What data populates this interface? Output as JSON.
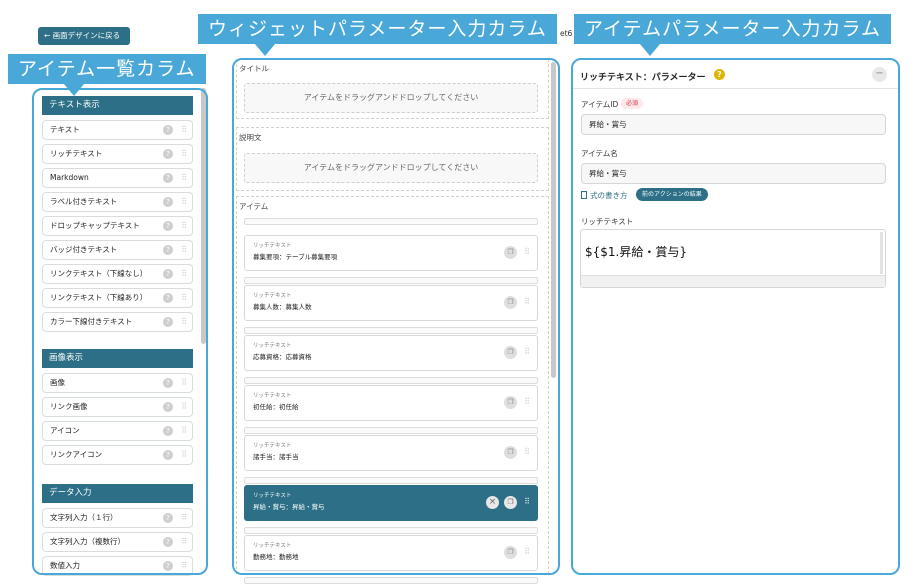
{
  "callouts": {
    "col1": "アイテム一覧カラム",
    "col2": "ウィジェットパラメーター入力カラム",
    "col3": "アイテムパラメーター入力カラム"
  },
  "colors": {
    "accent": "#4aa8d8",
    "header": "#2c6f86"
  },
  "back_button": "← 画面デザインに戻る",
  "partial_text": "et6",
  "item_list": {
    "sections": [
      {
        "title": "テキスト表示",
        "items": [
          "テキスト",
          "リッチテキスト",
          "Markdown",
          "ラベル付きテキスト",
          "ドロップキャップテキスト",
          "バッジ付きテキスト",
          "リンクテキスト（下線なし）",
          "リンクテキスト（下線あり）",
          "カラー下線付きテキスト"
        ]
      },
      {
        "title": "画像表示",
        "items": [
          "画像",
          "リンク画像",
          "アイコン",
          "リンクアイコン"
        ]
      },
      {
        "title": "データ入力",
        "items": [
          "文字列入力（１行）",
          "文字列入力（複数行）",
          "数値入力"
        ]
      }
    ],
    "help_glyph": "?",
    "drag_glyph": "⠿"
  },
  "widget": {
    "title_label": "タイトル",
    "desc_label": "説明文",
    "items_label": "アイテム",
    "drop_text": "アイテムをドラッグアンドドロップしてください",
    "cards": [
      {
        "type": "リッチテキスト",
        "name": "募集要項：テーブル募集要項",
        "selected": false
      },
      {
        "type": "リッチテキスト",
        "name": "募集人数：募集人数",
        "selected": false
      },
      {
        "type": "リッチテキスト",
        "name": "応募資格：応募資格",
        "selected": false
      },
      {
        "type": "リッチテキスト",
        "name": "初任給：初任給",
        "selected": false
      },
      {
        "type": "リッチテキスト",
        "name": "諸手当：諸手当",
        "selected": false
      },
      {
        "type": "リッチテキスト",
        "name": "昇給・賞与：昇給・賞与",
        "selected": true
      },
      {
        "type": "リッチテキスト",
        "name": "勤務地：勤務地",
        "selected": false
      }
    ]
  },
  "params": {
    "title": "リッチテキスト：パラメーター",
    "help": "?",
    "collapse": "−",
    "id_label": "アイテムID",
    "required": "必須",
    "id_value": "昇給・賞与",
    "name_label": "アイテム名",
    "name_value": "昇給・賞与",
    "formula_link": "式の書き方",
    "action_badge": "前のアクションの結果",
    "rich_label": "リッチテキスト",
    "rich_value": "${$1.昇給・賞与}"
  }
}
